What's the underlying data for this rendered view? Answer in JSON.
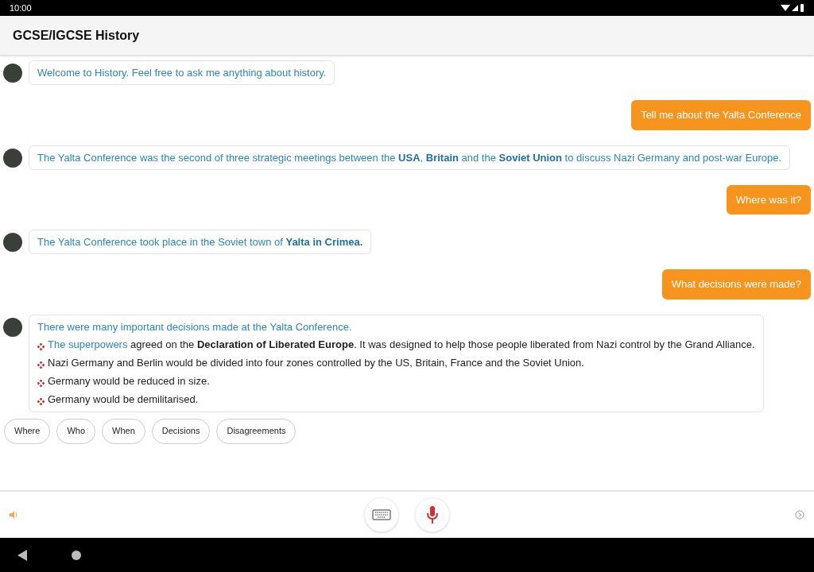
{
  "status_bar": {
    "time": "10:00"
  },
  "app_bar": {
    "title": "GCSE/IGCSE History"
  },
  "messages": [
    {
      "kind": "bot",
      "text": "Welcome to History. Feel free to ask me anything about history."
    },
    {
      "kind": "user",
      "text": "Tell me about the Yalta Conference"
    },
    {
      "kind": "bot",
      "text": "The Yalta Conference was the second of three strategic meetings between the **USA**, **Britain** and the **Soviet Union** to discuss Nazi Germany and post-war Europe."
    },
    {
      "kind": "user",
      "text": "Where was it?"
    },
    {
      "kind": "bot",
      "text": "The Yalta Conference took place in the Soviet town of **Yalta in Crimea.**"
    },
    {
      "kind": "user",
      "text": "What decisions were made?"
    },
    {
      "kind": "bot",
      "text": "There were many important decisions made at the Yalta Conference.",
      "bullets": [
        {
          "lead": "The superpowers",
          "text": "agreed on the **Declaration of Liberated Europe**. It was designed to help those people liberated from Nazi control by the Grand Alliance."
        },
        {
          "text": "Nazi Germany and Berlin would be divided into four zones controlled by the US, Britain, France and the Soviet Union."
        },
        {
          "text": "Germany would be reduced in size."
        },
        {
          "text": "Germany would be demilitarised."
        }
      ]
    }
  ],
  "suggestions": [
    "Where",
    "Who",
    "When",
    "Decisions",
    "Disagreements"
  ]
}
